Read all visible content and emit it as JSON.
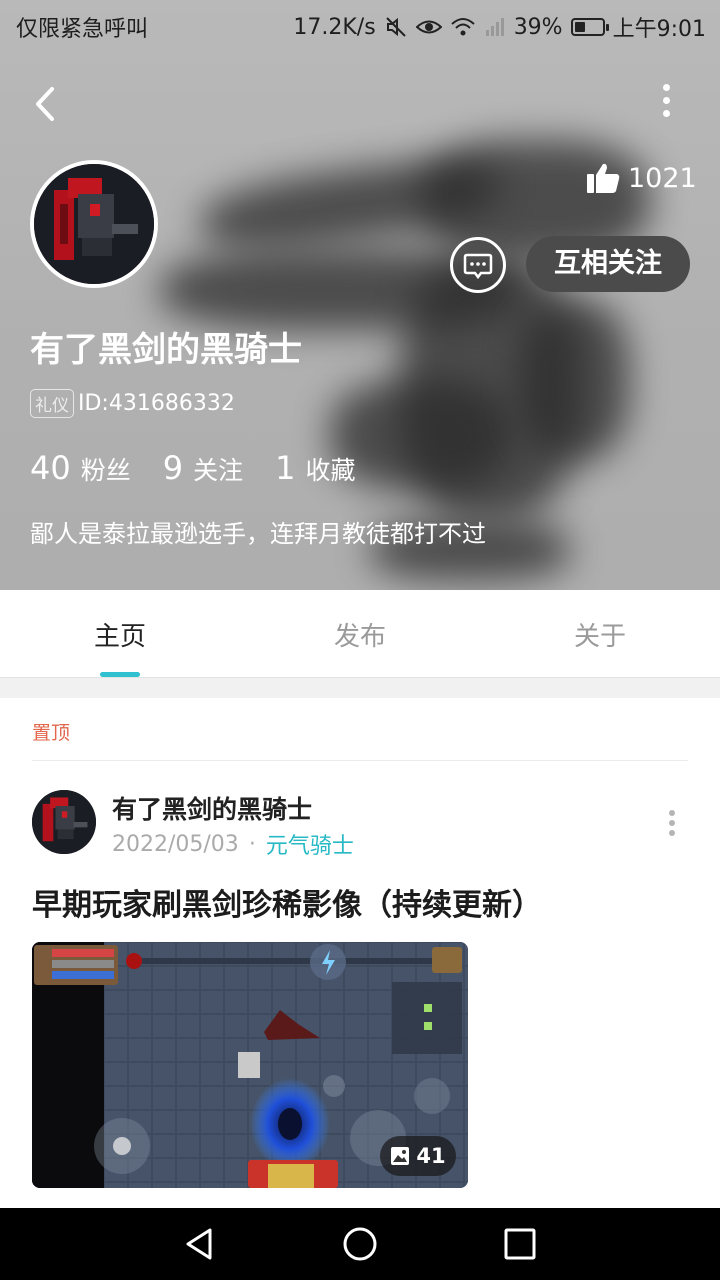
{
  "status_bar": {
    "carrier": "仅限紧急呼叫",
    "speed": "17.2K/s",
    "battery": "39%",
    "battery_level": 0.39,
    "time": "上午9:01"
  },
  "profile": {
    "likes": "1021",
    "follow_label": "互相关注",
    "nickname": "有了黑剑的黑骑士",
    "badge": "礼仪",
    "id_text": "ID:431686332",
    "stats": [
      {
        "num": "40",
        "label": "粉丝"
      },
      {
        "num": "9",
        "label": "关注"
      },
      {
        "num": "1",
        "label": "收藏"
      }
    ],
    "bio": "鄙人是泰拉最逊选手，连拜月教徒都打不过"
  },
  "tabs": [
    {
      "label": "主页"
    },
    {
      "label": "发布"
    },
    {
      "label": "关于"
    }
  ],
  "post": {
    "pinned_label": "置顶",
    "author": "有了黑剑的黑骑士",
    "date": "2022/05/03",
    "separator": "·",
    "category": "元气骑士",
    "title": "早期玩家刷黑剑珍稀影像（持续更新）",
    "image_count": "41"
  },
  "colors": {
    "accent": "#2fc1cf",
    "pinned": "#e2664b"
  }
}
